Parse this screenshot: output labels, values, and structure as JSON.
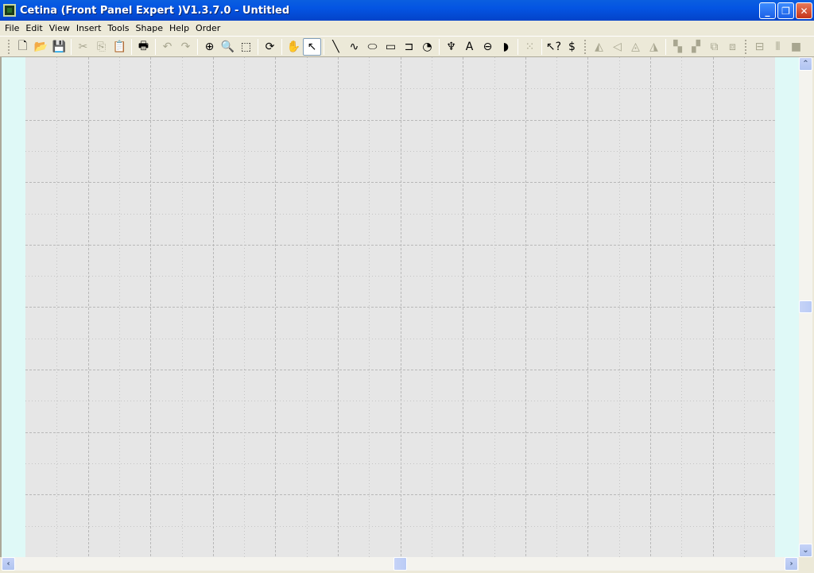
{
  "window": {
    "title": "Cetina (Front Panel Expert )V1.3.7.0 - Untitled",
    "minimize": "_",
    "restore": "❐",
    "close": "✕"
  },
  "menu": [
    "File",
    "Edit",
    "View",
    "Insert",
    "Tools",
    "Shape",
    "Help",
    "Order"
  ],
  "toolbar": [
    {
      "t": "grip"
    },
    {
      "n": "new-file-icon",
      "g": "🗋"
    },
    {
      "n": "open-folder-icon",
      "g": "📂"
    },
    {
      "n": "save-icon",
      "g": "💾"
    },
    {
      "t": "sep"
    },
    {
      "n": "cut-icon",
      "g": "✂",
      "d": true
    },
    {
      "n": "copy-icon",
      "g": "⎘",
      "d": true
    },
    {
      "n": "paste-icon",
      "g": "📋",
      "d": true
    },
    {
      "t": "sep"
    },
    {
      "n": "print-icon",
      "g": "🖶"
    },
    {
      "t": "sep"
    },
    {
      "n": "undo-icon",
      "g": "↶",
      "d": true
    },
    {
      "n": "redo-icon",
      "g": "↷",
      "d": true
    },
    {
      "t": "sep"
    },
    {
      "n": "zoom-in-icon",
      "g": "⊕"
    },
    {
      "n": "zoom-all-icon",
      "g": "🔍"
    },
    {
      "n": "zoom-fit-icon",
      "g": "⬚"
    },
    {
      "t": "sep"
    },
    {
      "n": "refresh-icon",
      "g": "⟳"
    },
    {
      "t": "sep"
    },
    {
      "n": "pan-hand-icon",
      "g": "✋"
    },
    {
      "n": "select-arrow-icon",
      "g": "↖",
      "a": true
    },
    {
      "t": "sep"
    },
    {
      "n": "line-tool-icon",
      "g": "╲"
    },
    {
      "n": "curve-tool-icon",
      "g": "∿"
    },
    {
      "n": "ellipse-tool-icon",
      "g": "⬭"
    },
    {
      "n": "rectangle-tool-icon",
      "g": "▭"
    },
    {
      "n": "rounded-rect-tool-icon",
      "g": "⊐"
    },
    {
      "n": "arc-tool-icon",
      "g": "◔"
    },
    {
      "t": "sep"
    },
    {
      "n": "component-icon",
      "g": "♆"
    },
    {
      "n": "text-tool-icon",
      "g": "A"
    },
    {
      "n": "connector-icon",
      "g": "⊖"
    },
    {
      "n": "d-shape-icon",
      "g": "◗"
    },
    {
      "t": "sep"
    },
    {
      "n": "grid-icon",
      "g": "⁙",
      "d": true
    },
    {
      "t": "sep"
    },
    {
      "n": "help-pointer-icon",
      "g": "↖?"
    },
    {
      "n": "order-dollar-icon",
      "g": "$"
    },
    {
      "t": "grip"
    },
    {
      "n": "flip-horizontal-icon",
      "g": "◭",
      "d": true
    },
    {
      "n": "flip-vertical-icon",
      "g": "◁",
      "d": true
    },
    {
      "n": "rotate-left-icon",
      "g": "◬",
      "d": true
    },
    {
      "n": "rotate-right-icon",
      "g": "◮",
      "d": true
    },
    {
      "t": "sep"
    },
    {
      "n": "bring-front-icon",
      "g": "▚",
      "d": true
    },
    {
      "n": "send-back-icon",
      "g": "▞",
      "d": true
    },
    {
      "n": "group-icon",
      "g": "⧉",
      "d": true
    },
    {
      "n": "ungroup-icon",
      "g": "⧈",
      "d": true
    },
    {
      "t": "grip"
    },
    {
      "n": "align-center-icon",
      "g": "⊟",
      "d": true
    },
    {
      "n": "align-middle-icon",
      "g": "⫴",
      "d": true
    },
    {
      "n": "same-size-icon",
      "g": "■",
      "d": true
    }
  ],
  "colors": {
    "canvas": "#e6e6e6",
    "grid_major": "#b8b8b8",
    "grid_minor": "#c4c4c4",
    "margin": "#dff9f7"
  }
}
